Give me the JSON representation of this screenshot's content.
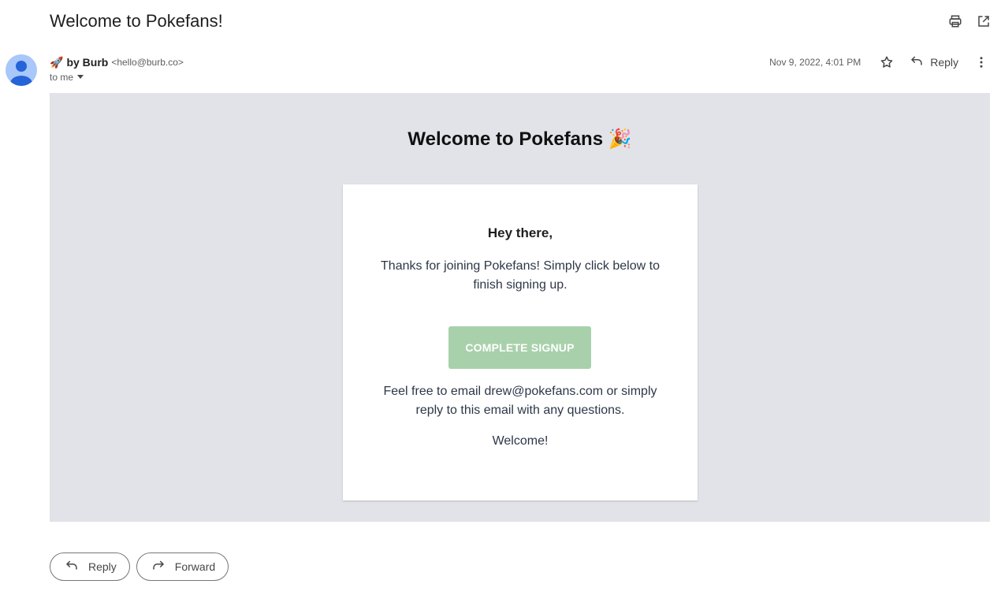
{
  "subject": "Welcome to Pokefans!",
  "toolbar": {
    "print_icon": "print-icon",
    "popout_icon": "open-in-new-window-icon"
  },
  "message": {
    "sender_emoji": "🚀",
    "sender_name": "by Burb",
    "sender_email": "<hello@burb.co>",
    "to_label": "to me",
    "date": "Nov 9, 2022, 4:01 PM",
    "reply_label": "Reply"
  },
  "body": {
    "hero_title": "Welcome to Pokefans 🎉",
    "greeting": "Hey there,",
    "intro": "Thanks for joining Pokefans! Simply click below to finish signing up.",
    "cta_label": "COMPLETE SIGNUP",
    "contact": "Feel free to email drew@pokefans.com or simply reply to this email with any questions.",
    "closing": "Welcome!"
  },
  "actions": {
    "reply_label": "Reply",
    "forward_label": "Forward"
  },
  "colors": {
    "body_background": "#e2e3e8",
    "cta_background": "#a8d1ab",
    "avatar": "#a8c7fa"
  }
}
